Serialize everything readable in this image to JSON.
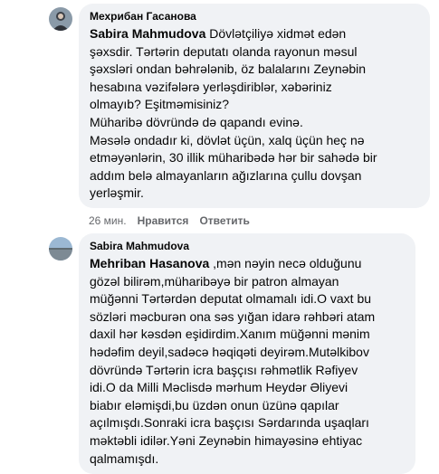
{
  "comment1": {
    "author": "Мехрибан Гасанова",
    "mention": "Sabira Mahmudova",
    "lines": [
      " Dövlətçiliyə xidmət edən",
      "şəxsdir. Tərtərin deputatı olanda rayonun məsul",
      "şəxsləri ondan bəhrələnib, öz balalarını Zeynəbin",
      "hesabına vəzifələrə yerləşdiriblər, xəbəriniz",
      "olmayıb? Eşitməmisiniz?",
      "Müharibə dövründə də qapandı evinə.",
      "Məsələ ondadır ki, dövlət üçün, xalq üçün heç nə",
      "etməyənlərin, 30 illik müharibədə hər bir sahədə bir",
      "addım belə almayanların ağızlarına çullu dovşan",
      "yerləşmir."
    ],
    "time": "26 мин.",
    "like_label": "Нравится",
    "reply_label": "Ответить"
  },
  "comment2": {
    "author": "Sabira Mahmudova",
    "mention": "Mehriban Hasanova",
    "lines": [
      " ,mən nəyin necə olduğunu",
      "gözəl bilirəm,müharibəyə bir patron almayan",
      "müğənni Tərtərdən deputat olmamalı idi.O vaxt bu",
      "sözləri məcburən ona səs yığan idarə rəhbəri atam",
      "daxil hər kəsdən eşidirdim.Xanım müğənni mənim",
      "hədəfim deyil,sadəcə həqiqəti deyirəm.Mutəlkibov",
      "dövründə Tərtərin icra başçısı rəhmətlik Rəfiyev",
      "idi.O da Milli Məclisdə mərhum Heydər Əliyevi",
      "biabır eləmişdi,bu üzdən onun üzünə qapılar",
      "açılmışdı.Sonraki icra başçısı Sərdarında uşaqları",
      "məktəbli idilər.Yəni Zeynəbin himayəsinə ehtiyac",
      "qalmamışdı."
    ]
  }
}
